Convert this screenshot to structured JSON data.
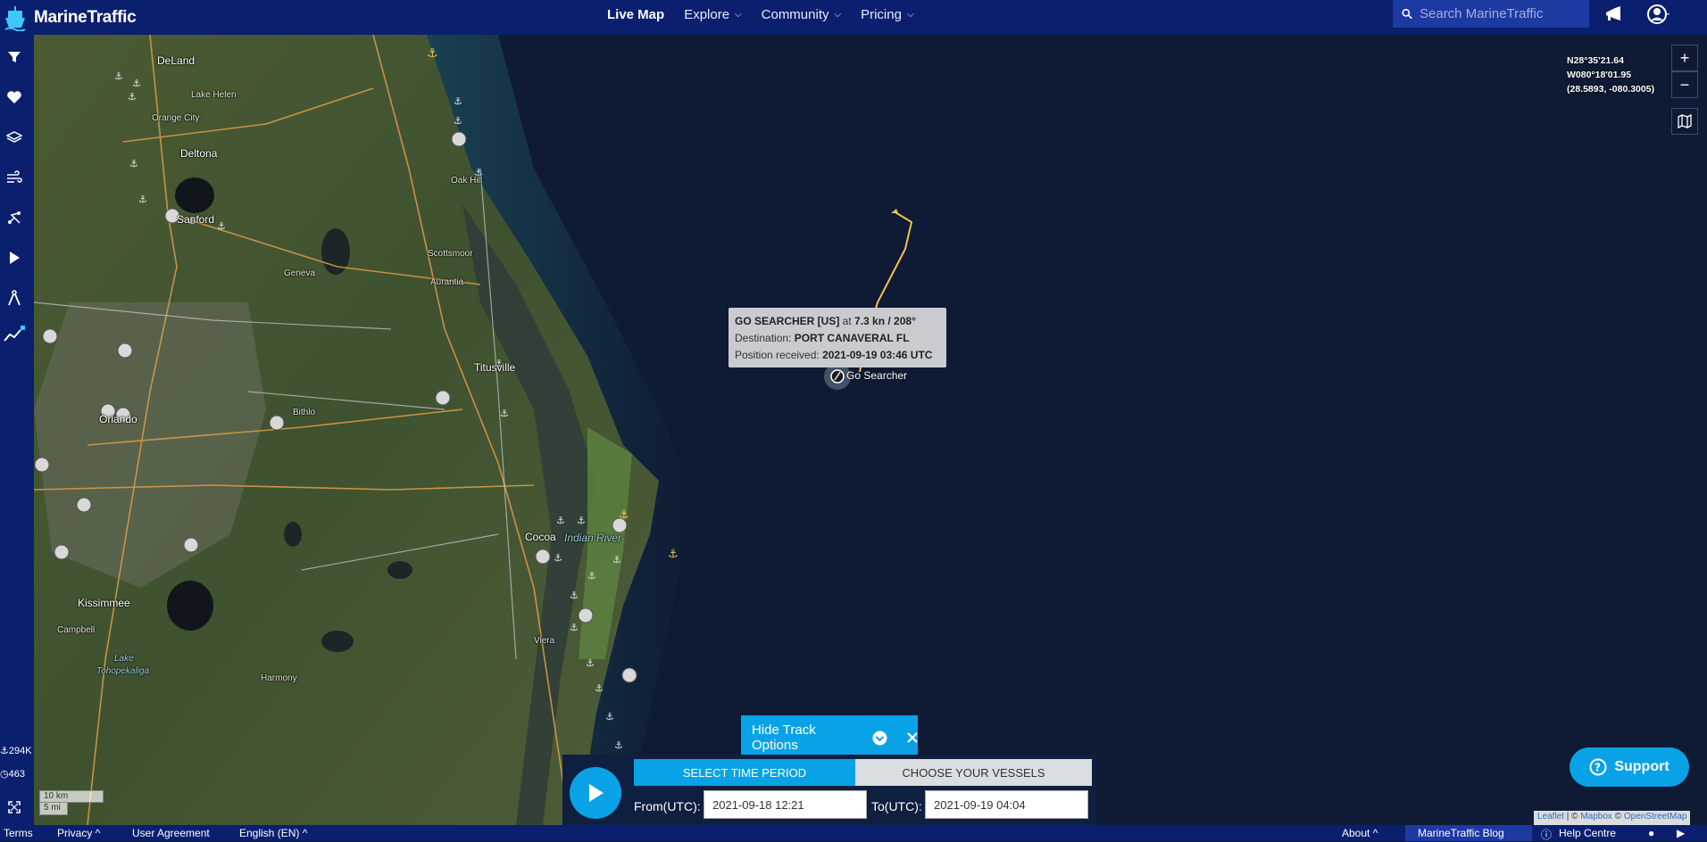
{
  "app": {
    "name": "MarineTraffic"
  },
  "nav": {
    "items": [
      {
        "label": "Live Map",
        "active": true
      },
      {
        "label": "Explore"
      },
      {
        "label": "Community"
      },
      {
        "label": "Pricing"
      }
    ]
  },
  "search": {
    "placeholder": "Search MarineTraffic"
  },
  "sidebar": {
    "buttons": [
      "filter-icon",
      "heart-icon",
      "layers-icon",
      "wind-icon",
      "route-icon",
      "play-icon",
      "measure-icon",
      "chart-lock-icon"
    ],
    "stats": [
      "294K",
      "463"
    ]
  },
  "map": {
    "places": [
      "DeLand",
      "Lake Helen",
      "Orange City",
      "Deltona",
      "Oak Hill",
      "Sanford",
      "Scottsmoor",
      "Geneva",
      "Aurantia",
      "Titusville",
      "Bithlo",
      "Orlando",
      "Cocoa",
      "Indian River",
      "Kissimmee",
      "Viera",
      "Campbell",
      "Lake",
      "Tohopekaliga",
      "Harmony"
    ],
    "coords": [
      "N28°35'21.64",
      "W080°18'01.95",
      "(28.5893, -080.3005)"
    ],
    "zoom_in": "+",
    "zoom_out": "−",
    "scale": [
      "10 km",
      "5 mi"
    ],
    "attribution": {
      "leaflet": "Leaflet",
      "sep1": " | © ",
      "mapbox": "Mapbox",
      "sep2": " © ",
      "osm": "OpenStreetMap"
    }
  },
  "vessel": {
    "name": "GO SEARCHER [US]",
    "at": " at ",
    "speed_course": "7.3 kn / 208°",
    "dest_label": "Destination: ",
    "destination": "PORT CANAVERAL FL",
    "pos_label": "Position received: ",
    "position_received": "2021-09-19 03:46 UTC",
    "map_label": "Go Searcher"
  },
  "track": {
    "hide_label": "Hide Track Options",
    "tab_time": "SELECT TIME PERIOD",
    "tab_vessels": "CHOOSE YOUR VESSELS",
    "from_label": "From(UTC):",
    "from_value": "2021-09-18 12:21",
    "to_label": "To(UTC):",
    "to_value": "2021-09-19 04:04"
  },
  "support": {
    "label": "Support"
  },
  "footer": {
    "left": [
      "Terms",
      "Privacy ^",
      "User Agreement",
      "English (EN) ^"
    ],
    "about": "About ^",
    "blog": "MarineTraffic Blog",
    "help": "Help Centre"
  },
  "colors": {
    "topbar": "#0a1f6e",
    "accent": "#0aa2e6",
    "sea": "#0e1a33",
    "track": "#f2c14e"
  }
}
